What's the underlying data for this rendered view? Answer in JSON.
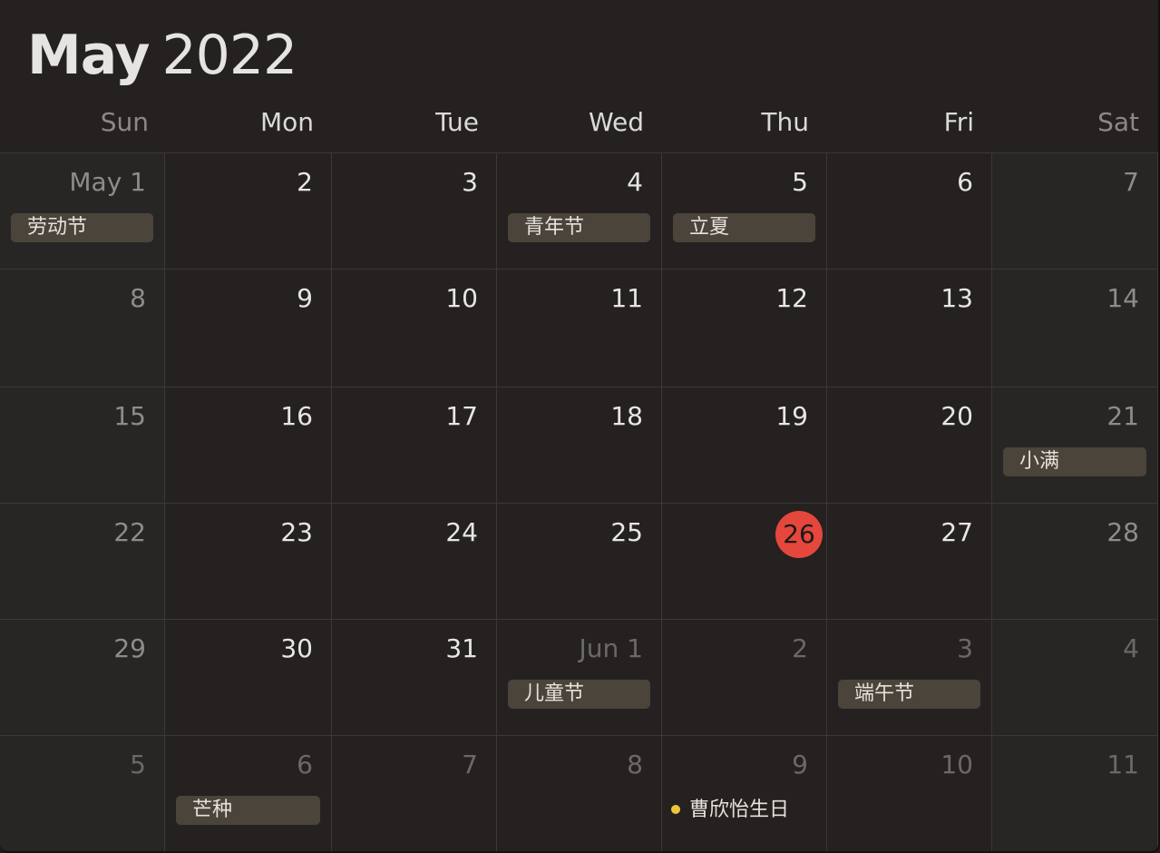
{
  "header": {
    "month": "May",
    "year": "2022"
  },
  "weekdays": [
    "Sun",
    "Mon",
    "Tue",
    "Wed",
    "Thu",
    "Fri",
    "Sat"
  ],
  "colors": {
    "today": "#e5473c",
    "event_background": "#4a443b",
    "event_dot": "#f0c43a"
  },
  "weeks": [
    [
      {
        "label": "May 1",
        "other": false,
        "event": "劳动节"
      },
      {
        "label": "2",
        "other": false
      },
      {
        "label": "3",
        "other": false
      },
      {
        "label": "4",
        "other": false,
        "event": "青年节"
      },
      {
        "label": "5",
        "other": false,
        "event": "立夏"
      },
      {
        "label": "6",
        "other": false
      },
      {
        "label": "7",
        "other": false
      }
    ],
    [
      {
        "label": "8",
        "other": false
      },
      {
        "label": "9",
        "other": false
      },
      {
        "label": "10",
        "other": false
      },
      {
        "label": "11",
        "other": false
      },
      {
        "label": "12",
        "other": false
      },
      {
        "label": "13",
        "other": false
      },
      {
        "label": "14",
        "other": false
      }
    ],
    [
      {
        "label": "15",
        "other": false
      },
      {
        "label": "16",
        "other": false
      },
      {
        "label": "17",
        "other": false
      },
      {
        "label": "18",
        "other": false
      },
      {
        "label": "19",
        "other": false
      },
      {
        "label": "20",
        "other": false
      },
      {
        "label": "21",
        "other": false,
        "event": "小满"
      }
    ],
    [
      {
        "label": "22",
        "other": false
      },
      {
        "label": "23",
        "other": false
      },
      {
        "label": "24",
        "other": false
      },
      {
        "label": "25",
        "other": false
      },
      {
        "label": "26",
        "other": false,
        "today": true
      },
      {
        "label": "27",
        "other": false
      },
      {
        "label": "28",
        "other": false
      }
    ],
    [
      {
        "label": "29",
        "other": false
      },
      {
        "label": "30",
        "other": false
      },
      {
        "label": "31",
        "other": false
      },
      {
        "label": "Jun 1",
        "other": true,
        "event": "儿童节"
      },
      {
        "label": "2",
        "other": true
      },
      {
        "label": "3",
        "other": true,
        "event": "端午节"
      },
      {
        "label": "4",
        "other": true
      }
    ],
    [
      {
        "label": "5",
        "other": true
      },
      {
        "label": "6",
        "other": true,
        "event": "芒种"
      },
      {
        "label": "7",
        "other": true
      },
      {
        "label": "8",
        "other": true
      },
      {
        "label": "9",
        "other": true,
        "dot_event": "曹欣怡生日"
      },
      {
        "label": "10",
        "other": true
      },
      {
        "label": "11",
        "other": true
      }
    ]
  ]
}
